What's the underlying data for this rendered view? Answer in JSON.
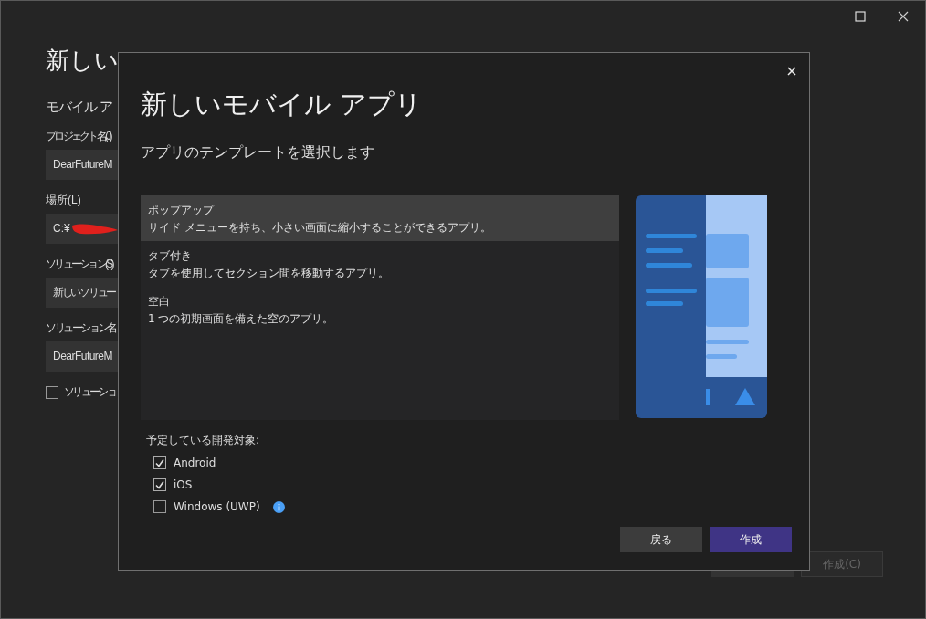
{
  "background": {
    "title": "新しい",
    "subtitle": "モバイル ア",
    "fields": [
      {
        "label": "プロジェクト名(J)",
        "value": "DearFutureM"
      },
      {
        "label": "場所(L)",
        "value": "C:¥"
      },
      {
        "label": "ソリューション(S)",
        "value": "新しいソリュー"
      },
      {
        "label": "ソリューション名",
        "value": "DearFutureM"
      }
    ],
    "checkbox": {
      "label": "ソリューショ",
      "checked": false
    },
    "buttons": [
      {
        "label": "作成(C)",
        "disabled": true
      }
    ]
  },
  "dialog": {
    "title": "新しいモバイル アプリ",
    "subtitle": "アプリのテンプレートを選択します",
    "templates": [
      {
        "name": "ポップアップ",
        "description": "サイド メニューを持ち、小さい画面に縮小することができるアプリ。",
        "selected": true
      },
      {
        "name": "タブ付き",
        "description": "タブを使用してセクション間を移動するアプリ。",
        "selected": false
      },
      {
        "name": "空白",
        "description": "1 つの初期画面を備えた空のアプリ。",
        "selected": false
      }
    ],
    "targets_label": "予定している開発対象:",
    "targets": [
      {
        "label": "Android",
        "checked": true,
        "info": false
      },
      {
        "label": "iOS",
        "checked": true,
        "info": false
      },
      {
        "label": "Windows (UWP)",
        "checked": false,
        "info": true
      }
    ],
    "buttons": [
      {
        "label": "戻る",
        "kind": "secondary"
      },
      {
        "label": "作成",
        "kind": "primary"
      }
    ]
  }
}
